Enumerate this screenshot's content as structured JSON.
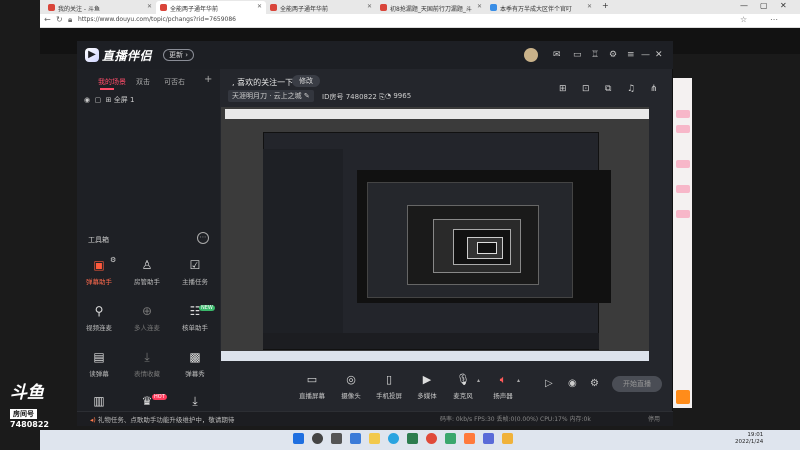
{
  "browser": {
    "tabs": [
      {
        "label": "我的关注 - 斗鱼",
        "active": false
      },
      {
        "label": "全能两子通年华前",
        "active": true
      },
      {
        "label": "全能两子通年华前",
        "active": false
      },
      {
        "label": "初8抢漏题_天国前行刀漏题_斗",
        "active": false
      },
      {
        "label": "本季有万半成大区伴个官叮",
        "active": false
      }
    ],
    "url": "https://www.douyu.com/topic/pchangs?rid=7659086"
  },
  "app": {
    "logo_text": "直播伴侣",
    "version_btn": "更新",
    "left_tabs": [
      "我的场景",
      "双击",
      "可否右"
    ],
    "scene_item": "全屏 1",
    "toolbox_title": "工具箱",
    "tools": [
      {
        "label": "弹幕助手",
        "icon": "barrage-icon",
        "hot": true
      },
      {
        "label": "房管助手",
        "icon": "person-icon",
        "hot": false
      },
      {
        "label": "主播任务",
        "icon": "task-icon",
        "hot": false
      },
      {
        "label": "视频连麦",
        "icon": "mic-link-icon",
        "hot": false
      },
      {
        "label": "多人连麦",
        "icon": "multi-link-icon",
        "hot": false
      },
      {
        "label": "核单助手",
        "icon": "order-icon",
        "hot": false
      },
      {
        "label": "读弹幕",
        "icon": "read-icon",
        "hot": false
      },
      {
        "label": "表情收藏",
        "icon": "download-icon",
        "hot": false
      },
      {
        "label": "弹幕秀",
        "icon": "show-icon",
        "hot": false
      }
    ],
    "header": {
      "follow_text": ", 喜欢的关注一下",
      "edit_btn": "修改",
      "category": "天涯明月刀 · 云上之城",
      "room_label": "ID房号",
      "room_id": "7480822",
      "viewers": "9965"
    },
    "controls": [
      {
        "label": "直播屏幕",
        "icon": "screen-icon"
      },
      {
        "label": "摄像头",
        "icon": "camera-icon"
      },
      {
        "label": "手机投屏",
        "icon": "phone-icon"
      },
      {
        "label": "多媒体",
        "icon": "media-icon"
      },
      {
        "label": "麦克风",
        "icon": "microphone-icon"
      },
      {
        "label": "扬声器",
        "icon": "speaker-icon"
      }
    ],
    "start_btn": "开始直播",
    "status": {
      "tip": "礼物任务、点歌助手功能升级维护中，敬请期待",
      "stats": "码率: 0kb/s    FPS:30    丢帧:0(0.00%)    CPU:17%    内存:0k",
      "pause": "停用"
    }
  },
  "watermark": {
    "brand": "斗鱼",
    "sub": "房间号",
    "room": "7480822"
  },
  "taskbar": {
    "time": "19:01",
    "date": "2022/1/24"
  },
  "colors": {
    "accent": "#ff4d6a",
    "tool_hot": "#ff5a3c"
  }
}
